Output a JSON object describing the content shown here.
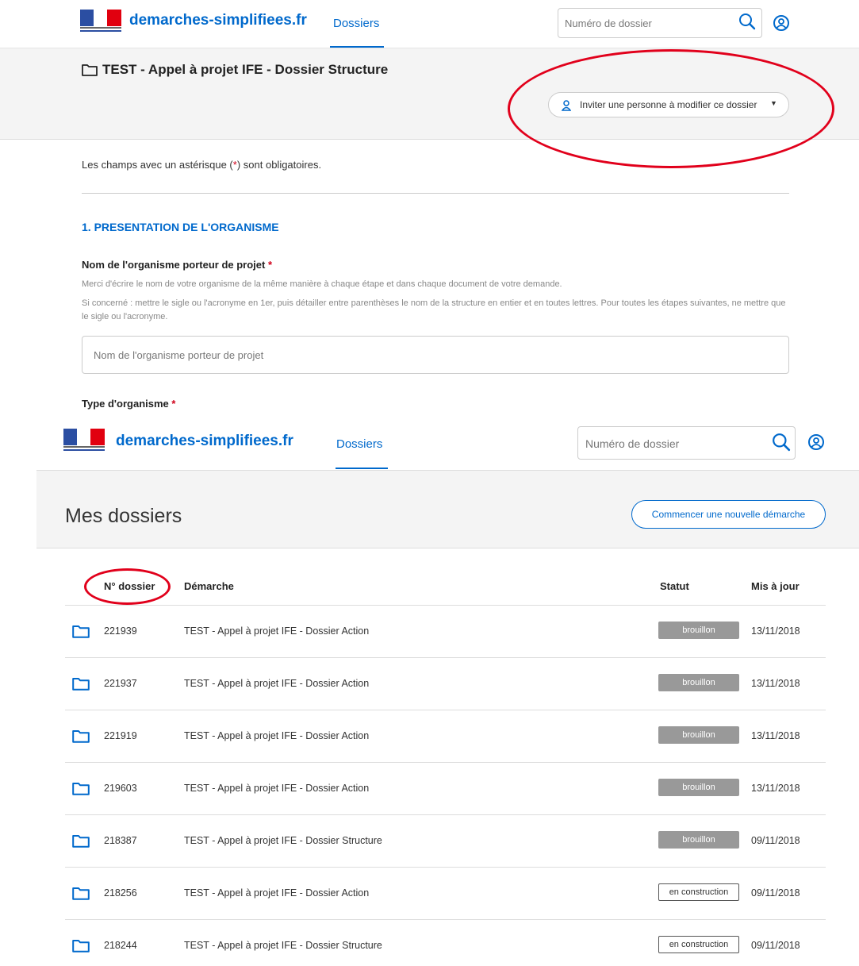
{
  "brand": "demarches-simplifiees.fr",
  "nav": {
    "dossiers": "Dossiers"
  },
  "search": {
    "placeholder": "Numéro de dossier"
  },
  "edit_view": {
    "title": "TEST - Appel à projet IFE - Dossier Structure",
    "invite_button": "Inviter une personne à modifier ce dossier",
    "required_note_prefix": "Les champs avec un astérisque (",
    "required_note_star": "*",
    "required_note_suffix": ") sont obligatoires.",
    "section_title": "1. PRESENTATION DE L'ORGANISME",
    "field1": {
      "label": "Nom de l'organisme porteur de projet",
      "required": "*",
      "desc1": "Merci d'écrire le nom de votre organisme de la même manière à chaque étape et dans chaque document de votre demande.",
      "desc2": "Si concerné : mettre le sigle ou l'acronyme en 1er, puis détailler entre parenthèses le nom de la structure en entier et en toutes lettres. Pour toutes les étapes suivantes, ne mettre que le sigle ou l'acronyme.",
      "placeholder": "Nom de l'organisme porteur de projet"
    },
    "field2": {
      "label": "Type d'organisme",
      "required": "*"
    }
  },
  "list_view": {
    "title": "Mes dossiers",
    "new_button": "Commencer une nouvelle démarche",
    "columns": {
      "number": "N° dossier",
      "demarche": "Démarche",
      "status": "Statut",
      "updated": "Mis à jour"
    },
    "rows": [
      {
        "number": "221939",
        "demarche": "TEST - Appel à projet IFE - Dossier Action",
        "status": "brouillon",
        "date": "13/11/2018"
      },
      {
        "number": "221937",
        "demarche": "TEST - Appel à projet IFE - Dossier Action",
        "status": "brouillon",
        "date": "13/11/2018"
      },
      {
        "number": "221919",
        "demarche": "TEST - Appel à projet IFE - Dossier Action",
        "status": "brouillon",
        "date": "13/11/2018"
      },
      {
        "number": "219603",
        "demarche": "TEST - Appel à projet IFE - Dossier Action",
        "status": "brouillon",
        "date": "13/11/2018"
      },
      {
        "number": "218387",
        "demarche": "TEST - Appel à projet IFE - Dossier Structure",
        "status": "brouillon",
        "date": "09/11/2018"
      },
      {
        "number": "218256",
        "demarche": "TEST - Appel à projet IFE - Dossier Action",
        "status": "en construction",
        "date": "09/11/2018"
      },
      {
        "number": "218244",
        "demarche": "TEST - Appel à projet IFE - Dossier Structure",
        "status": "en construction",
        "date": "09/11/2018"
      }
    ]
  },
  "colors": {
    "brand_blue": "#0069cc",
    "annotation_red": "#e1001b",
    "draft_badge": "#999999"
  }
}
